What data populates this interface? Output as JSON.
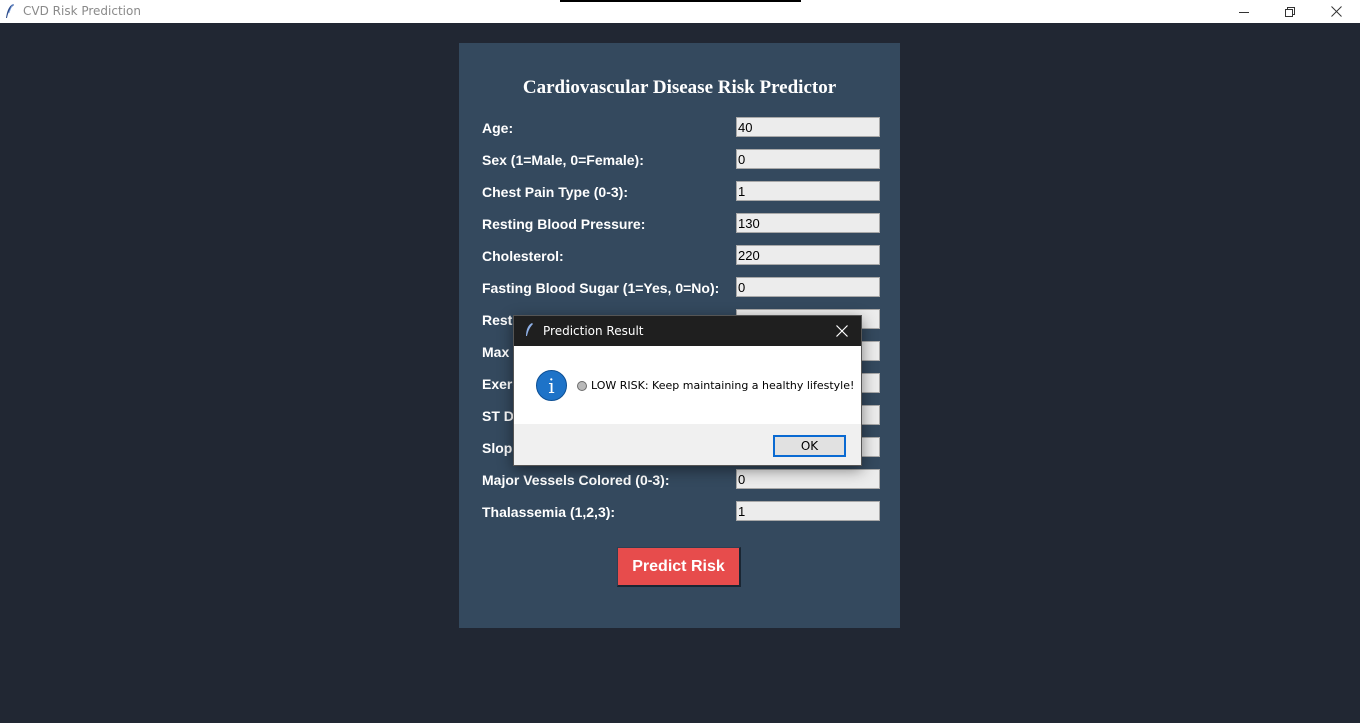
{
  "window": {
    "title": "CVD Risk Prediction",
    "controls": [
      "minimize-icon",
      "maximize-icon",
      "close-icon"
    ]
  },
  "form": {
    "title": "Cardiovascular Disease Risk Predictor",
    "fields": [
      {
        "label": "Age:",
        "value": "40"
      },
      {
        "label": "Sex (1=Male, 0=Female):",
        "value": "0"
      },
      {
        "label": "Chest Pain Type (0-3):",
        "value": "1"
      },
      {
        "label": "Resting Blood Pressure:",
        "value": "130"
      },
      {
        "label": "Cholesterol:",
        "value": "220"
      },
      {
        "label": "Fasting Blood Sugar (1=Yes, 0=No):",
        "value": "0"
      },
      {
        "label": "Resti",
        "value": ""
      },
      {
        "label": "Max",
        "value": ""
      },
      {
        "label": "Exerc",
        "value": ""
      },
      {
        "label": "ST D",
        "value": ""
      },
      {
        "label": "Slop",
        "value": ""
      },
      {
        "label": "Major Vessels Colored (0-3):",
        "value": "0"
      },
      {
        "label": "Thalassemia (1,2,3):",
        "value": "1"
      }
    ],
    "predict_button": "Predict Risk"
  },
  "dialog": {
    "title": "Prediction Result",
    "icon": "info-icon",
    "message": "LOW RISK: Keep maintaining a healthy lifestyle!",
    "ok_label": "OK"
  },
  "colors": {
    "background": "#212733",
    "panel": "#34495e",
    "predict_button": "#e74c4c",
    "dialog_titlebar": "#1f1f1f",
    "info_icon": "#1e73c8"
  }
}
